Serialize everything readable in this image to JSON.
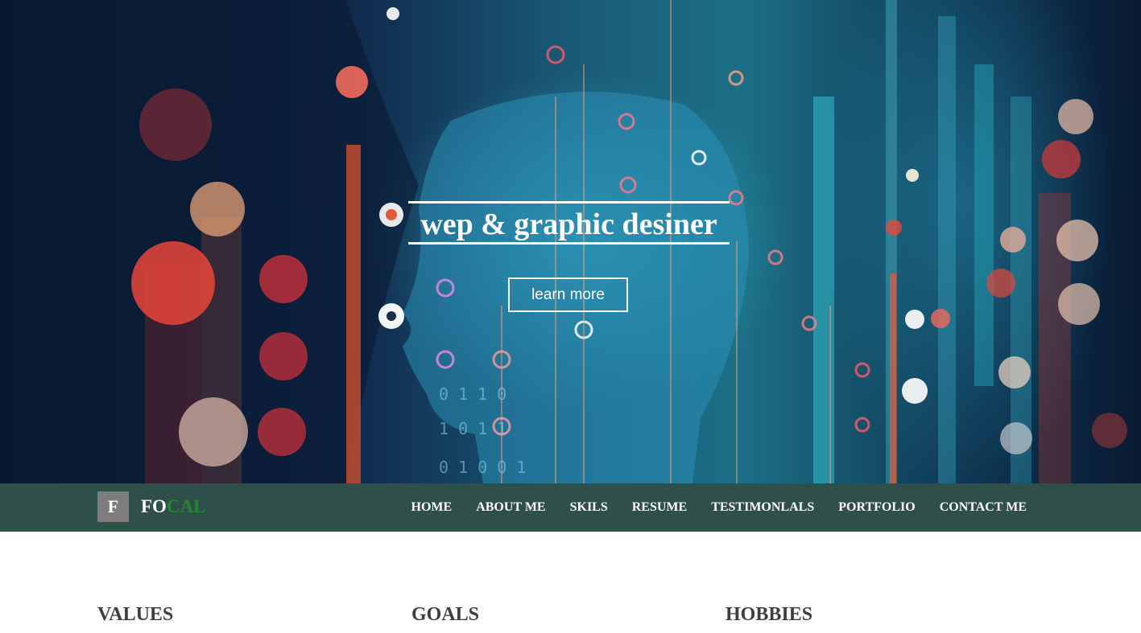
{
  "hero": {
    "title": "wep & graphic desiner",
    "button_label": "learn more"
  },
  "brand": {
    "badge_letter": "F",
    "name_part1": "FO",
    "name_part2": "CAL"
  },
  "nav": {
    "items": [
      "HOME",
      "ABOUT ME",
      "SKILS",
      "RESUME",
      "TESTIMONLALS",
      "PORTFOLIO",
      "CONTACT ME"
    ]
  },
  "sections": {
    "headings": [
      "VALUES",
      "GOALS",
      "HOBBIES"
    ]
  },
  "colors": {
    "navbar_bg": "#2f4f4a",
    "brand_accent": "#1f8a2a",
    "badge_bg": "#7d7d7d",
    "heading_text": "#3e3e3e"
  }
}
